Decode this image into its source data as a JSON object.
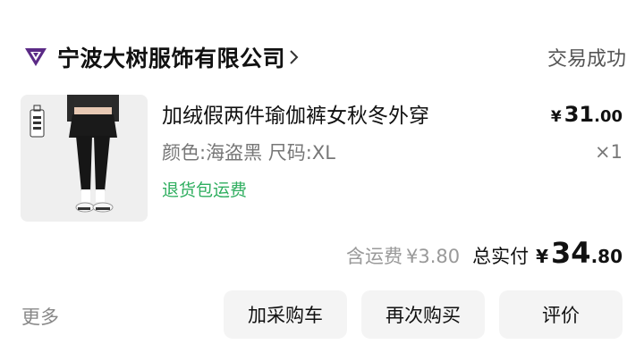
{
  "shop": {
    "name": "宁波大树服饰有限公司",
    "status": "交易成功",
    "logo_icon": "shop-logo-icon",
    "brand_color": "#5b2a86"
  },
  "product": {
    "title": "加绒假两件瑜伽裤女秋冬外穿",
    "spec": "颜色:海盗黑 尺码:XL",
    "tag": "退货包运费",
    "tag_color": "#2fae5f",
    "image_label": "海盗黑",
    "price_currency": "¥",
    "price_int": "31",
    "price_dec": ".00",
    "quantity": "×1"
  },
  "summary": {
    "shipping_label": "含运费",
    "shipping_value": "¥3.80",
    "total_label": "总实付",
    "total_currency": "¥",
    "total_int": "34",
    "total_dec": ".80"
  },
  "actions": {
    "more_label": "更多",
    "add_cart_label": "加采购车",
    "rebuy_label": "再次购买",
    "review_label": "评价"
  }
}
